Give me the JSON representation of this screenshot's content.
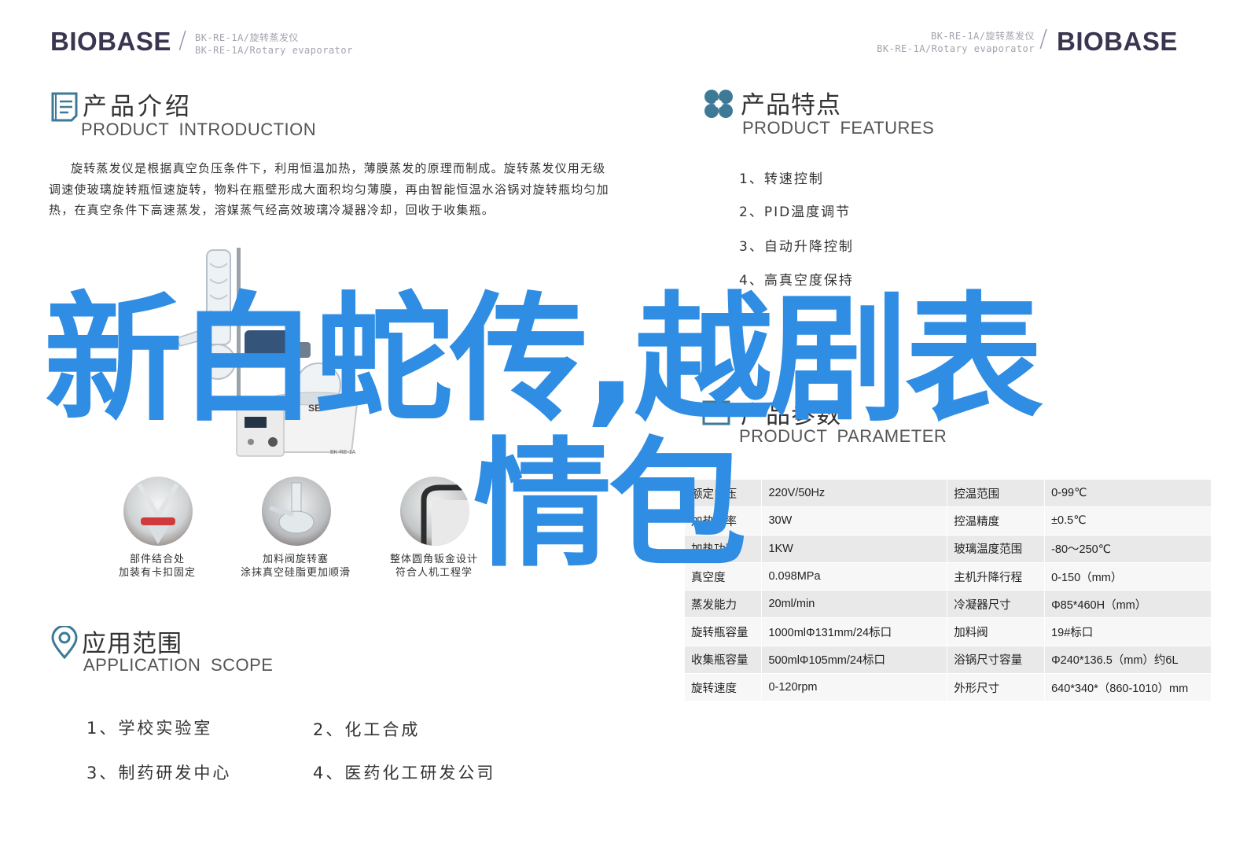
{
  "header": {
    "brand": "BIOBASE",
    "model_cn": "BK-RE-1A/旋转蒸发仪",
    "model_en": "BK-RE-1A/Rotary evaporator"
  },
  "intro": {
    "title_cn": "产品介绍",
    "title_en": "PRODUCT INTRODUCTION",
    "icon": "document-icon",
    "paragraph": "旋转蒸发仪是根据真空负压条件下，利用恒温加热，薄膜蒸发的原理而制成。旋转蒸发仪用无级调速使玻璃旋转瓶恒速旋转，物料在瓶壁形成大面积均匀薄膜，再由智能恒温水浴锅对旋转瓶均匀加热，在真空条件下高速蒸发，溶媒蒸气经高效玻璃冷凝器冷却，回收于收集瓶。"
  },
  "device": {
    "brand_fragment": "SE",
    "model_label": "BK-RE-1A"
  },
  "details": [
    {
      "line1": "部件结合处",
      "line2": "加装有卡扣固定"
    },
    {
      "line1": "加料阀旋转塞",
      "line2": "涂抹真空硅脂更加顺滑"
    },
    {
      "line1": "整体圆角钣金设计",
      "line2": "符合人机工程学"
    }
  ],
  "features": {
    "title_cn": "产品特点",
    "title_en": "PRODUCT  FEATURES",
    "icon": "fan-icon",
    "items": [
      "1、转速控制",
      "2、PID温度调节",
      "3、自动升降控制",
      "4、高真空度保持"
    ]
  },
  "parameters": {
    "title_cn": "产品参数",
    "title_en": "PRODUCT  PARAMETER",
    "rows": [
      [
        "额定电压",
        "220V/50Hz",
        "控温范围",
        "0-99℃"
      ],
      [
        "加热功率",
        "30W",
        "控温精度",
        "±0.5℃"
      ],
      [
        "加热功率",
        "1KW",
        "玻璃温度范围",
        "-80～250℃"
      ],
      [
        "真空度",
        "0.098MPa",
        "主机升降行程",
        "0-150（mm）"
      ],
      [
        "蒸发能力",
        "20ml/min",
        "冷凝器尺寸",
        "Φ85*460H（mm）"
      ],
      [
        "旋转瓶容量",
        "1000mlΦ131mm/24标口",
        "加料阀",
        "19#标口"
      ],
      [
        "收集瓶容量",
        "500mlΦ105mm/24标口",
        "浴锅尺寸容量",
        "Φ240*136.5（mm）约6L"
      ],
      [
        "旋转速度",
        "0-120rpm",
        "外形尺寸",
        "640*340*（860-1010）mm"
      ]
    ]
  },
  "application": {
    "title_cn": "应用范围",
    "title_en": "APPLICATION  SCOPE",
    "icon": "location-pin-icon",
    "items": [
      "1、学校实验室",
      "2、化工合成",
      "3、制药研发中心",
      "4、医药化工研发公司"
    ]
  },
  "overlay": {
    "line1": "新白蛇传,越剧表",
    "line2": "情包"
  },
  "colors": {
    "overlay_blue": "#2f8de4",
    "brand_dark": "#3a3550",
    "icon_teal": "#3e7a95"
  }
}
